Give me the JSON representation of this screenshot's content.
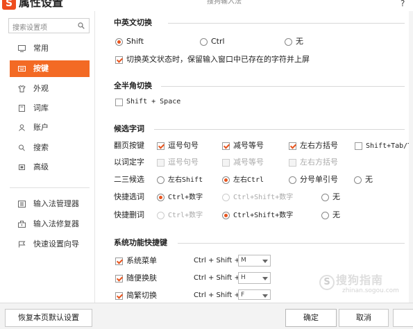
{
  "window": {
    "title": "属性设置",
    "app_name": "搜狗输入法",
    "help": "?",
    "logo_letter": "S"
  },
  "sidebar": {
    "search_placeholder": "搜索设置项",
    "items": [
      {
        "label": "常用",
        "icon": "monitor-icon"
      },
      {
        "label": "按键",
        "icon": "keyboard-icon",
        "selected": true
      },
      {
        "label": "外观",
        "icon": "shirt-icon"
      },
      {
        "label": "词库",
        "icon": "book-icon"
      },
      {
        "label": "账户",
        "icon": "person-icon"
      },
      {
        "label": "搜索",
        "icon": "search-icon"
      },
      {
        "label": "高级",
        "icon": "advanced-icon"
      }
    ],
    "tools": [
      {
        "label": "输入法管理器",
        "icon": "manager-icon"
      },
      {
        "label": "输入法修复器",
        "icon": "toolbox-icon"
      },
      {
        "label": "快速设置向导",
        "icon": "flag-icon"
      }
    ]
  },
  "lang_switch": {
    "title": "中英文切换",
    "options": [
      "Shift",
      "Ctrl",
      "无"
    ],
    "selected": "Shift",
    "commit_label": "切换英文状态时，保留输入窗口中已存在的字符并上屏",
    "commit_checked": true
  },
  "width_switch": {
    "title": "全半角切换",
    "shortcut": "Shift + Space",
    "checked": false
  },
  "candidate": {
    "title": "候选字词",
    "rows": [
      {
        "label": "翻页按键",
        "options": [
          {
            "text": "逗号句号",
            "checked": true
          },
          {
            "text": "减号等号",
            "checked": true
          },
          {
            "text": "左右方括号",
            "checked": true
          },
          {
            "text": "Shift+Tab/Tab",
            "checked": false
          }
        ]
      },
      {
        "label": "以词定字",
        "options": [
          {
            "text": "逗号句号",
            "checked": false,
            "disabled": true
          },
          {
            "text": "减号等号",
            "checked": false,
            "disabled": true
          },
          {
            "text": "左右方括号",
            "checked": false,
            "disabled": true
          }
        ]
      },
      {
        "label": "二三候选",
        "options": [
          {
            "text": "左右Shift",
            "selected": false
          },
          {
            "text": "左右Ctrl",
            "selected": true
          },
          {
            "text": "分号单引号",
            "selected": false
          },
          {
            "text": "无",
            "selected": false
          }
        ]
      },
      {
        "label": "快捷选词",
        "options": [
          {
            "text": "Ctrl+数字",
            "selected": true
          },
          {
            "text": "Ctrl+Shift+数字",
            "selected": false,
            "disabled": true
          },
          {
            "text": "无",
            "selected": false
          }
        ]
      },
      {
        "label": "快捷删词",
        "options": [
          {
            "text": "Ctrl+数字",
            "selected": false,
            "disabled": true
          },
          {
            "text": "Ctrl+Shift+数字",
            "selected": true
          },
          {
            "text": "无",
            "selected": false
          }
        ]
      }
    ]
  },
  "hotkeys": {
    "title": "系统功能快捷键",
    "prefix": "Ctrl + Shift +",
    "items": [
      {
        "label": "系统菜单",
        "checked": true,
        "key": "M"
      },
      {
        "label": "随便换肤",
        "checked": true,
        "key": "H"
      },
      {
        "label": "简繁切换",
        "checked": true,
        "key": "F"
      }
    ]
  },
  "footer": {
    "restore_label": "恢复本页默认设置",
    "ok_label": "确定",
    "cancel_label": "取消"
  },
  "watermark": {
    "text": "搜狗指南",
    "sub": "zhinan.sogou.com",
    "circle": "S"
  },
  "colors": {
    "accent": "#f36a24",
    "check": "#e8541e"
  }
}
